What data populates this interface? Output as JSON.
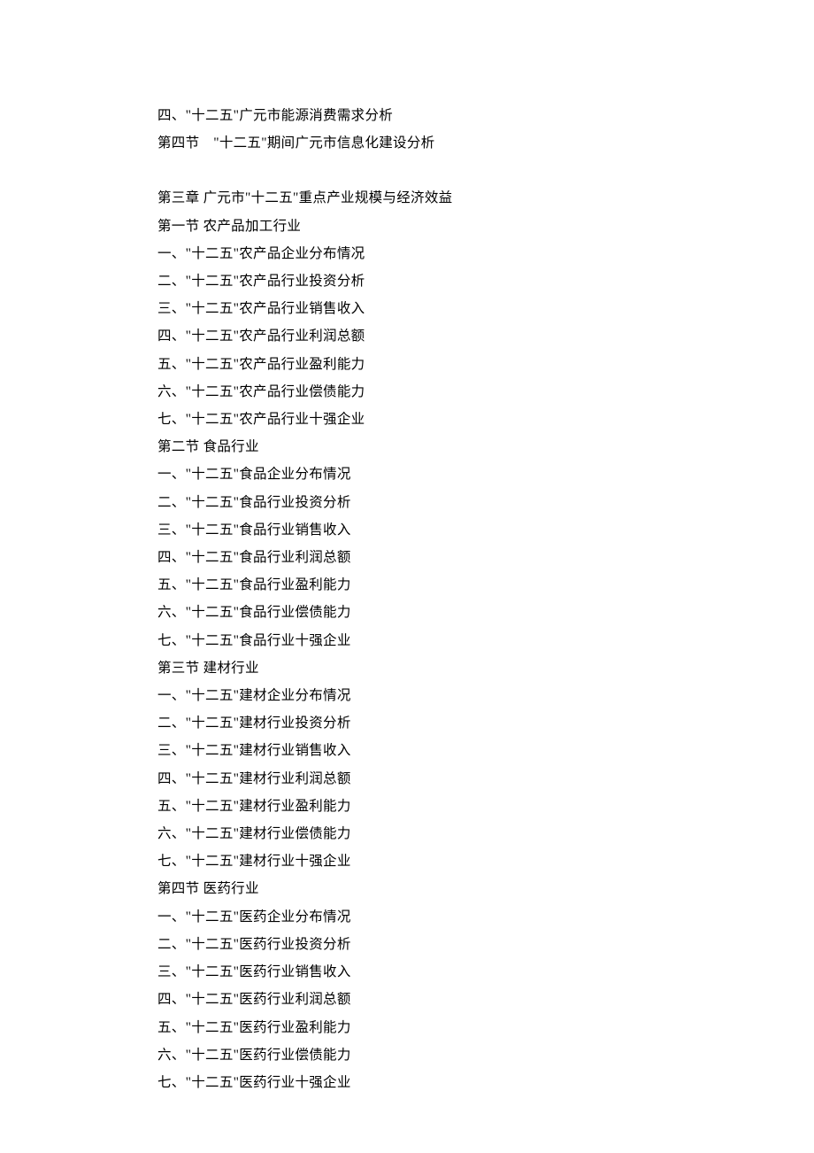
{
  "lines": [
    "四、\"十二五\"广元市能源消费需求分析",
    "第四节　\"十二五\"期间广元市信息化建设分析",
    "",
    "第三章  广元市\"十二五\"重点产业规模与经济效益",
    "第一节  农产品加工行业",
    "一、\"十二五\"农产品企业分布情况",
    "二、\"十二五\"农产品行业投资分析",
    "三、\"十二五\"农产品行业销售收入",
    "四、\"十二五\"农产品行业利润总额",
    "五、\"十二五\"农产品行业盈利能力",
    "六、\"十二五\"农产品行业偿债能力",
    "七、\"十二五\"农产品行业十强企业",
    "第二节  食品行业",
    "一、\"十二五\"食品企业分布情况",
    "二、\"十二五\"食品行业投资分析",
    "三、\"十二五\"食品行业销售收入",
    "四、\"十二五\"食品行业利润总额",
    "五、\"十二五\"食品行业盈利能力",
    "六、\"十二五\"食品行业偿债能力",
    "七、\"十二五\"食品行业十强企业",
    "第三节  建材行业",
    "一、\"十二五\"建材企业分布情况",
    "二、\"十二五\"建材行业投资分析",
    "三、\"十二五\"建材行业销售收入",
    "四、\"十二五\"建材行业利润总额",
    "五、\"十二五\"建材行业盈利能力",
    "六、\"十二五\"建材行业偿债能力",
    "七、\"十二五\"建材行业十强企业",
    "第四节  医药行业",
    "一、\"十二五\"医药企业分布情况",
    "二、\"十二五\"医药行业投资分析",
    "三、\"十二五\"医药行业销售收入",
    "四、\"十二五\"医药行业利润总额",
    "五、\"十二五\"医药行业盈利能力",
    "六、\"十二五\"医药行业偿债能力",
    "七、\"十二五\"医药行业十强企业"
  ]
}
